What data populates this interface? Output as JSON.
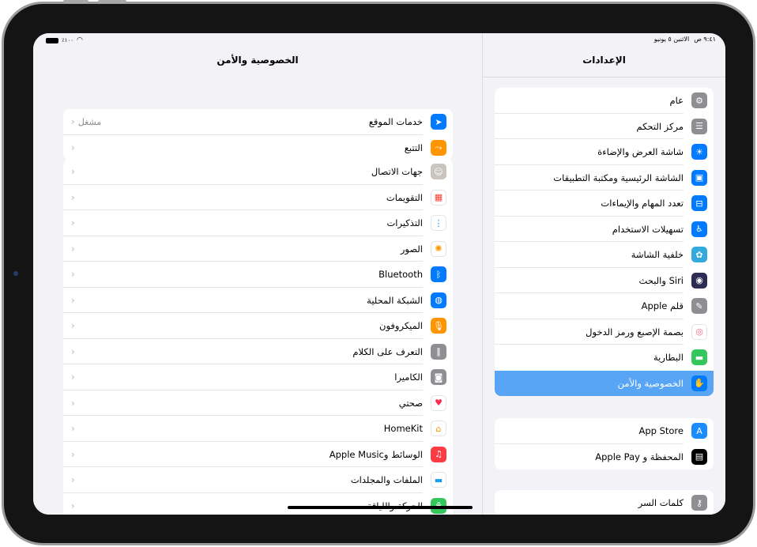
{
  "status_bar": {
    "time": "٩:٤١ ص",
    "date": "الاثنين ٥ يونيو",
    "battery": "٪١٠٠",
    "wifi_icon": "wifi-icon",
    "battery_icon": "battery-icon"
  },
  "sidebar": {
    "title": "الإعدادات",
    "groups": [
      {
        "items": [
          {
            "label": "عام",
            "icon": "gear-icon",
            "color": "#8e8e93"
          },
          {
            "label": "مركز التحكم",
            "icon": "toggles-icon",
            "color": "#8e8e93"
          },
          {
            "label": "شاشة العرض والإضاءة",
            "icon": "sun-icon",
            "color": "#007aff"
          },
          {
            "label": "الشاشة الرئيسية ومكتبة التطبيقات",
            "icon": "home-screen-icon",
            "color": "#007aff"
          },
          {
            "label": "تعدد المهام والإيماءات",
            "icon": "multitasking-icon",
            "color": "#007aff"
          },
          {
            "label": "تسهيلات الاستخدام",
            "icon": "accessibility-icon",
            "color": "#007aff"
          },
          {
            "label": "خلفية الشاشة",
            "icon": "wallpaper-flower-icon",
            "color": "#34aadc"
          },
          {
            "label": "Siri والبحث",
            "icon": "siri-icon",
            "color": "#2c2c54"
          },
          {
            "label": "قلم Apple",
            "icon": "pencil-icon",
            "color": "#8e8e93"
          },
          {
            "label": "بصمة الإصبع ورمز الدخول",
            "icon": "fingerprint-icon",
            "color": "#ffffff"
          },
          {
            "label": "البطارية",
            "icon": "battery-icon",
            "color": "#34c759"
          },
          {
            "label": "الخصوصية والأمن",
            "icon": "hand-icon",
            "color": "#007aff",
            "selected": true
          }
        ]
      },
      {
        "items": [
          {
            "label": "App Store",
            "icon": "app-store-icon",
            "color": "#1a8cff"
          },
          {
            "label": "المحفظة و Apple Pay",
            "icon": "wallet-icon",
            "color": "#000000"
          }
        ]
      },
      {
        "items": [
          {
            "label": "كلمات السر",
            "icon": "key-icon",
            "color": "#8e8e93"
          }
        ]
      }
    ]
  },
  "detail": {
    "title": "الخصوصية والأمن",
    "groups": [
      {
        "items": [
          {
            "label": "خدمات الموقع",
            "value": "مشغل",
            "icon": "location-arrow-icon",
            "color": "#007aff"
          },
          {
            "label": "التتبع",
            "value": "",
            "icon": "tracking-icon",
            "color": "#ff9500"
          }
        ]
      },
      {
        "items": [
          {
            "label": "جهات الاتصال",
            "icon": "contacts-icon",
            "color": "#c9c5bd"
          },
          {
            "label": "التقويمات",
            "icon": "calendar-icon",
            "color": "#ffffff"
          },
          {
            "label": "التذكيرات",
            "icon": "reminders-icon",
            "color": "#ffffff"
          },
          {
            "label": "الصور",
            "icon": "photos-icon",
            "color": "#ffffff"
          },
          {
            "label": "Bluetooth",
            "icon": "bluetooth-icon",
            "color": "#007aff"
          },
          {
            "label": "الشبكة المحلية",
            "icon": "globe-icon",
            "color": "#007aff"
          },
          {
            "label": "الميكروفون",
            "icon": "microphone-icon",
            "color": "#ff9500"
          },
          {
            "label": "التعرف على الكلام",
            "icon": "waveform-icon",
            "color": "#8e8e93"
          },
          {
            "label": "الكاميرا",
            "icon": "camera-icon",
            "color": "#8e8e93"
          },
          {
            "label": "صحتي",
            "icon": "heart-icon",
            "color": "#ffffff"
          },
          {
            "label": "HomeKit",
            "icon": "home-icon",
            "color": "#ffffff"
          },
          {
            "label": "الوسائط وApple Music",
            "icon": "music-icon",
            "color": "#fc3c44"
          },
          {
            "label": "الملفات والمجلدات",
            "icon": "folder-icon",
            "color": "#ffffff"
          },
          {
            "label": "الحركة واللياقة",
            "icon": "fitness-icon",
            "color": "#34c759"
          }
        ]
      }
    ]
  }
}
